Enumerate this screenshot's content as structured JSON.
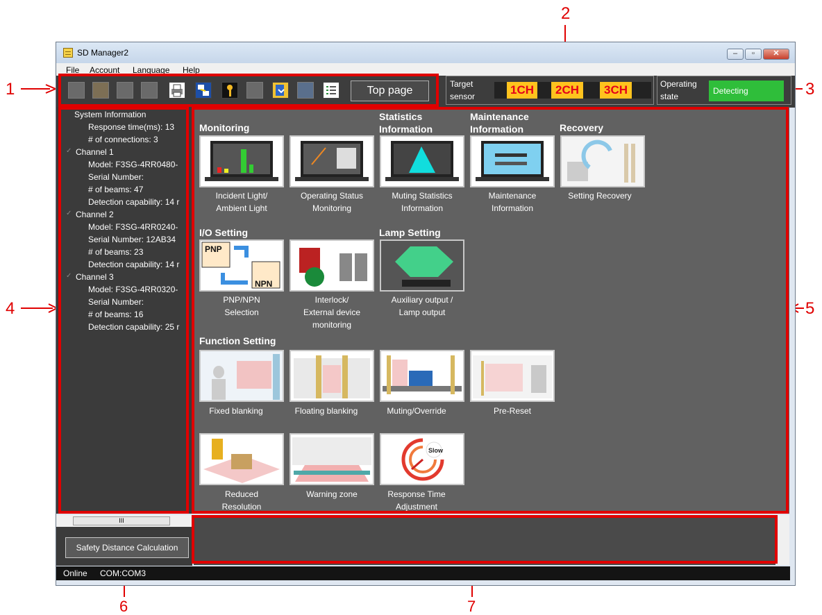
{
  "callouts": [
    "1",
    "2",
    "3",
    "4",
    "5",
    "6",
    "7"
  ],
  "window": {
    "title": "SD Manager2",
    "controls": [
      "minimize",
      "maximize",
      "close"
    ]
  },
  "menu": [
    "File",
    "Account",
    "Language",
    "Help"
  ],
  "toolbar": {
    "icons": [
      "new-file-icon",
      "open-file-icon",
      "save-icon",
      "save-as-icon",
      "print-icon",
      "connect-icon",
      "key-icon",
      "lock-icon",
      "import-icon",
      "export-icon",
      "list-icon"
    ],
    "top_page_label": "Top page"
  },
  "target_sensor": {
    "label_line1": "Target",
    "label_line2": "sensor",
    "channels": [
      "1CH",
      "2CH",
      "3CH"
    ]
  },
  "operating_state": {
    "label_line1": "Operating",
    "label_line2": "state",
    "value": "Detecting"
  },
  "tree": [
    {
      "text": "System Information",
      "level": 0
    },
    {
      "text": "Response time(ms): 13",
      "level": 1
    },
    {
      "text": "# of connections: 3",
      "level": 1
    },
    {
      "text": "Channel 1",
      "level": 0
    },
    {
      "text": "Model: F3SG-4RR0480-",
      "level": 1
    },
    {
      "text": "Serial Number:",
      "level": 1
    },
    {
      "text": "# of beams: 47",
      "level": 1
    },
    {
      "text": "Detection capability: 14 r",
      "level": 1
    },
    {
      "text": "Channel 2",
      "level": 0
    },
    {
      "text": "Model: F3SG-4RR0240-",
      "level": 1
    },
    {
      "text": "Serial Number: 12AB34",
      "level": 1
    },
    {
      "text": "# of beams: 23",
      "level": 1
    },
    {
      "text": "Detection capability: 14 r",
      "level": 1
    },
    {
      "text": "Channel 3",
      "level": 0
    },
    {
      "text": "Model: F3SG-4RR0320-",
      "level": 1
    },
    {
      "text": "Serial Number:",
      "level": 1
    },
    {
      "text": "# of beams: 16",
      "level": 1
    },
    {
      "text": "Detection capability: 25 r",
      "level": 1
    }
  ],
  "hscroll_label": "III",
  "safety_button": "Safety Distance Calculation",
  "sections": {
    "monitoring": "Monitoring",
    "statistics_l1": "Statistics",
    "statistics_l2": "Information",
    "maintenance_l1": "Maintenance",
    "maintenance_l2": "Information",
    "recovery": "Recovery",
    "io_setting": "I/O Setting",
    "lamp_setting": "Lamp Setting",
    "function_setting": "Function Setting"
  },
  "tiles": {
    "incident": [
      "Incident Light/",
      "Ambient Light"
    ],
    "opstatus": [
      "Operating Status",
      "Monitoring"
    ],
    "muting_stats": [
      "Muting Statistics",
      "Information"
    ],
    "maintenance": [
      "Maintenance",
      "Information"
    ],
    "recovery": [
      "Setting Recovery"
    ],
    "pnp": [
      "PNP/NPN",
      "Selection"
    ],
    "interlock": [
      "Interlock/",
      "External device",
      "monitoring"
    ],
    "aux": [
      "Auxiliary output /",
      "Lamp output"
    ],
    "fixed": [
      "Fixed blanking"
    ],
    "floating": [
      "Floating blanking"
    ],
    "muting": [
      "Muting/Override"
    ],
    "prereset": [
      "Pre-Reset"
    ],
    "reduced": [
      "Reduced",
      "Resolution"
    ],
    "warning": [
      "Warning zone"
    ],
    "response": [
      "Response Time",
      "Adjustment"
    ]
  },
  "pnp_icon_text": [
    "PNP",
    "NPN"
  ],
  "slow_text": "Slow",
  "status": {
    "mode": "Online",
    "port": "COM:COM3"
  },
  "colors": {
    "annotation": "#e00000",
    "detecting": "#2fbe3a",
    "channel_tag": "#ffc31e",
    "channel_text": "#e3001a"
  }
}
